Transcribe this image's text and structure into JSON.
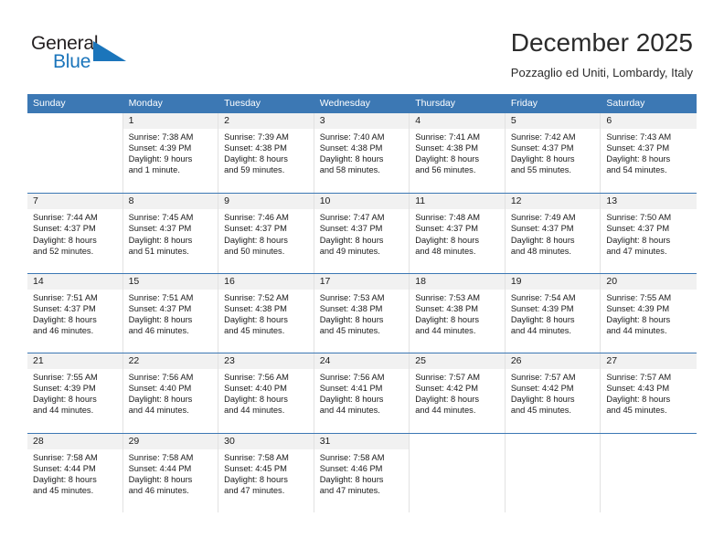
{
  "logo": {
    "word_one": "General",
    "word_two": "Blue",
    "triangle_color": "#1b75bb"
  },
  "header": {
    "title": "December 2025",
    "subtitle": "Pozzaglio ed Uniti, Lombardy, Italy"
  },
  "theme": {
    "header_blue": "#3c78b4",
    "daynum_bg": "#f1f1f1",
    "cell_border": "#e2e2e2"
  },
  "weekday_headers": [
    "Sunday",
    "Monday",
    "Tuesday",
    "Wednesday",
    "Thursday",
    "Friday",
    "Saturday"
  ],
  "weeks": [
    [
      {
        "day": "",
        "sunrise": "",
        "sunset": "",
        "daylight_line1": "",
        "daylight_line2": ""
      },
      {
        "day": "1",
        "sunrise": "Sunrise: 7:38 AM",
        "sunset": "Sunset: 4:39 PM",
        "daylight_line1": "Daylight: 9 hours",
        "daylight_line2": "and 1 minute."
      },
      {
        "day": "2",
        "sunrise": "Sunrise: 7:39 AM",
        "sunset": "Sunset: 4:38 PM",
        "daylight_line1": "Daylight: 8 hours",
        "daylight_line2": "and 59 minutes."
      },
      {
        "day": "3",
        "sunrise": "Sunrise: 7:40 AM",
        "sunset": "Sunset: 4:38 PM",
        "daylight_line1": "Daylight: 8 hours",
        "daylight_line2": "and 58 minutes."
      },
      {
        "day": "4",
        "sunrise": "Sunrise: 7:41 AM",
        "sunset": "Sunset: 4:38 PM",
        "daylight_line1": "Daylight: 8 hours",
        "daylight_line2": "and 56 minutes."
      },
      {
        "day": "5",
        "sunrise": "Sunrise: 7:42 AM",
        "sunset": "Sunset: 4:37 PM",
        "daylight_line1": "Daylight: 8 hours",
        "daylight_line2": "and 55 minutes."
      },
      {
        "day": "6",
        "sunrise": "Sunrise: 7:43 AM",
        "sunset": "Sunset: 4:37 PM",
        "daylight_line1": "Daylight: 8 hours",
        "daylight_line2": "and 54 minutes."
      }
    ],
    [
      {
        "day": "7",
        "sunrise": "Sunrise: 7:44 AM",
        "sunset": "Sunset: 4:37 PM",
        "daylight_line1": "Daylight: 8 hours",
        "daylight_line2": "and 52 minutes."
      },
      {
        "day": "8",
        "sunrise": "Sunrise: 7:45 AM",
        "sunset": "Sunset: 4:37 PM",
        "daylight_line1": "Daylight: 8 hours",
        "daylight_line2": "and 51 minutes."
      },
      {
        "day": "9",
        "sunrise": "Sunrise: 7:46 AM",
        "sunset": "Sunset: 4:37 PM",
        "daylight_line1": "Daylight: 8 hours",
        "daylight_line2": "and 50 minutes."
      },
      {
        "day": "10",
        "sunrise": "Sunrise: 7:47 AM",
        "sunset": "Sunset: 4:37 PM",
        "daylight_line1": "Daylight: 8 hours",
        "daylight_line2": "and 49 minutes."
      },
      {
        "day": "11",
        "sunrise": "Sunrise: 7:48 AM",
        "sunset": "Sunset: 4:37 PM",
        "daylight_line1": "Daylight: 8 hours",
        "daylight_line2": "and 48 minutes."
      },
      {
        "day": "12",
        "sunrise": "Sunrise: 7:49 AM",
        "sunset": "Sunset: 4:37 PM",
        "daylight_line1": "Daylight: 8 hours",
        "daylight_line2": "and 48 minutes."
      },
      {
        "day": "13",
        "sunrise": "Sunrise: 7:50 AM",
        "sunset": "Sunset: 4:37 PM",
        "daylight_line1": "Daylight: 8 hours",
        "daylight_line2": "and 47 minutes."
      }
    ],
    [
      {
        "day": "14",
        "sunrise": "Sunrise: 7:51 AM",
        "sunset": "Sunset: 4:37 PM",
        "daylight_line1": "Daylight: 8 hours",
        "daylight_line2": "and 46 minutes."
      },
      {
        "day": "15",
        "sunrise": "Sunrise: 7:51 AM",
        "sunset": "Sunset: 4:37 PM",
        "daylight_line1": "Daylight: 8 hours",
        "daylight_line2": "and 46 minutes."
      },
      {
        "day": "16",
        "sunrise": "Sunrise: 7:52 AM",
        "sunset": "Sunset: 4:38 PM",
        "daylight_line1": "Daylight: 8 hours",
        "daylight_line2": "and 45 minutes."
      },
      {
        "day": "17",
        "sunrise": "Sunrise: 7:53 AM",
        "sunset": "Sunset: 4:38 PM",
        "daylight_line1": "Daylight: 8 hours",
        "daylight_line2": "and 45 minutes."
      },
      {
        "day": "18",
        "sunrise": "Sunrise: 7:53 AM",
        "sunset": "Sunset: 4:38 PM",
        "daylight_line1": "Daylight: 8 hours",
        "daylight_line2": "and 44 minutes."
      },
      {
        "day": "19",
        "sunrise": "Sunrise: 7:54 AM",
        "sunset": "Sunset: 4:39 PM",
        "daylight_line1": "Daylight: 8 hours",
        "daylight_line2": "and 44 minutes."
      },
      {
        "day": "20",
        "sunrise": "Sunrise: 7:55 AM",
        "sunset": "Sunset: 4:39 PM",
        "daylight_line1": "Daylight: 8 hours",
        "daylight_line2": "and 44 minutes."
      }
    ],
    [
      {
        "day": "21",
        "sunrise": "Sunrise: 7:55 AM",
        "sunset": "Sunset: 4:39 PM",
        "daylight_line1": "Daylight: 8 hours",
        "daylight_line2": "and 44 minutes."
      },
      {
        "day": "22",
        "sunrise": "Sunrise: 7:56 AM",
        "sunset": "Sunset: 4:40 PM",
        "daylight_line1": "Daylight: 8 hours",
        "daylight_line2": "and 44 minutes."
      },
      {
        "day": "23",
        "sunrise": "Sunrise: 7:56 AM",
        "sunset": "Sunset: 4:40 PM",
        "daylight_line1": "Daylight: 8 hours",
        "daylight_line2": "and 44 minutes."
      },
      {
        "day": "24",
        "sunrise": "Sunrise: 7:56 AM",
        "sunset": "Sunset: 4:41 PM",
        "daylight_line1": "Daylight: 8 hours",
        "daylight_line2": "and 44 minutes."
      },
      {
        "day": "25",
        "sunrise": "Sunrise: 7:57 AM",
        "sunset": "Sunset: 4:42 PM",
        "daylight_line1": "Daylight: 8 hours",
        "daylight_line2": "and 44 minutes."
      },
      {
        "day": "26",
        "sunrise": "Sunrise: 7:57 AM",
        "sunset": "Sunset: 4:42 PM",
        "daylight_line1": "Daylight: 8 hours",
        "daylight_line2": "and 45 minutes."
      },
      {
        "day": "27",
        "sunrise": "Sunrise: 7:57 AM",
        "sunset": "Sunset: 4:43 PM",
        "daylight_line1": "Daylight: 8 hours",
        "daylight_line2": "and 45 minutes."
      }
    ],
    [
      {
        "day": "28",
        "sunrise": "Sunrise: 7:58 AM",
        "sunset": "Sunset: 4:44 PM",
        "daylight_line1": "Daylight: 8 hours",
        "daylight_line2": "and 45 minutes."
      },
      {
        "day": "29",
        "sunrise": "Sunrise: 7:58 AM",
        "sunset": "Sunset: 4:44 PM",
        "daylight_line1": "Daylight: 8 hours",
        "daylight_line2": "and 46 minutes."
      },
      {
        "day": "30",
        "sunrise": "Sunrise: 7:58 AM",
        "sunset": "Sunset: 4:45 PM",
        "daylight_line1": "Daylight: 8 hours",
        "daylight_line2": "and 47 minutes."
      },
      {
        "day": "31",
        "sunrise": "Sunrise: 7:58 AM",
        "sunset": "Sunset: 4:46 PM",
        "daylight_line1": "Daylight: 8 hours",
        "daylight_line2": "and 47 minutes."
      },
      {
        "day": "",
        "sunrise": "",
        "sunset": "",
        "daylight_line1": "",
        "daylight_line2": ""
      },
      {
        "day": "",
        "sunrise": "",
        "sunset": "",
        "daylight_line1": "",
        "daylight_line2": ""
      },
      {
        "day": "",
        "sunrise": "",
        "sunset": "",
        "daylight_line1": "",
        "daylight_line2": ""
      }
    ]
  ]
}
